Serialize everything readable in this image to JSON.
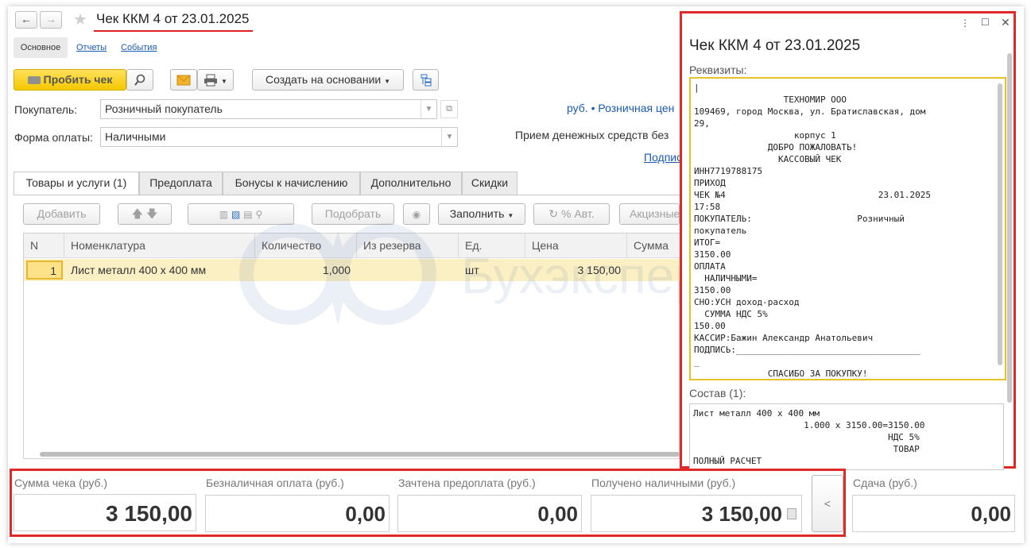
{
  "window": {
    "title": "Чек ККМ 4 от 23.01.2025",
    "back_glyph": "←",
    "forward_glyph": "→",
    "star_glyph": "★"
  },
  "nav_tabs": {
    "main": "Основное",
    "reports": "Отчеты",
    "events": "События"
  },
  "toolbar": {
    "punch_check": "Пробить чек",
    "create_based_on": "Создать на основании"
  },
  "form": {
    "buyer_label": "Покупатель:",
    "buyer_value": "Розничный покупатель",
    "payment_label": "Форма оплаты:",
    "payment_value": "Наличными",
    "price_link": "руб. • Розничная цен",
    "cash_receipt_text": "Прием денежных средств без",
    "sign_link": "Подпис"
  },
  "tabs": [
    {
      "label": "Товары и услуги (1)"
    },
    {
      "label": "Предоплата"
    },
    {
      "label": "Бонусы к начислению"
    },
    {
      "label": "Дополнительно"
    },
    {
      "label": "Скидки"
    }
  ],
  "table_toolbar": {
    "add": "Добавить",
    "select": "Подобрать",
    "fill": "Заполнить",
    "auto_percent": "% Авт.",
    "excise": "Акцизные"
  },
  "table": {
    "columns": [
      "N",
      "Номенклатура",
      "Количество",
      "Из резерва",
      "Ед.",
      "Цена",
      "Сумма"
    ],
    "rows": [
      {
        "n": "1",
        "item": "Лист металл 400 х 400 мм",
        "qty": "1,000",
        "reserve": "",
        "unit": "шт",
        "price": "3 150,00",
        "sum": ""
      }
    ]
  },
  "watermark": "Бухэксперт",
  "receipt_panel": {
    "title": "Чек ККМ 4 от 23.01.2025",
    "requisites_label": "Реквизиты:",
    "receipt_lines": [
      "|",
      "                 ТЕХНОМИР ООО",
      "109469, город Москва, ул. Братиславская, дом",
      "29,",
      "                   корпус 1",
      "              ДОБРО ПОЖАЛОВАТЬ!",
      "                КАССОВЫЙ ЧЕК",
      "ИНН7719788175",
      "ПРИХОД",
      "ЧЕК №4                             23.01.2025",
      "17:58",
      "ПОКУПАТЕЛЬ:                    Розничный",
      "покупатель",
      "ИТОГ=",
      "3150.00",
      "ОПЛАТА",
      "  НАЛИЧНЫМИ=",
      "3150.00",
      "СНО:УСН доход-расход",
      "  СУММА НДС 5%",
      "150.00",
      "КАССИР:Бажин Александр Анатольевич",
      "ПОДПИСЬ:___________________________________",
      "_",
      "              СПАСИБО ЗА ПОКУПКУ!"
    ],
    "sostav_label": "Состав (1):",
    "sostav_lines": [
      "Лист металл 400 х 400 мм",
      "                     1.000 x 3150.00=3150.00",
      "                                     НДС 5%",
      "                                      ТОВАР",
      "ПОЛНЫЙ РАСЧЕТ"
    ]
  },
  "totals": {
    "sum_label": "Сумма чека (руб.)",
    "sum_value": "3 150,00",
    "cashless_label": "Безналичная оплата (руб.)",
    "cashless_value": "0,00",
    "prepay_label": "Зачтена предоплата (руб.)",
    "prepay_value": "0,00",
    "cash_label": "Получено наличными (руб.)",
    "cash_value": "3 150,00",
    "change_label": "Сдача (руб.)",
    "change_value": "0,00",
    "collapse_glyph": "<"
  },
  "colors": {
    "highlight": "#e02a2a",
    "accent_yellow": "#f5c800",
    "link": "#1a5bb0",
    "row_selected": "#fbefc4"
  }
}
